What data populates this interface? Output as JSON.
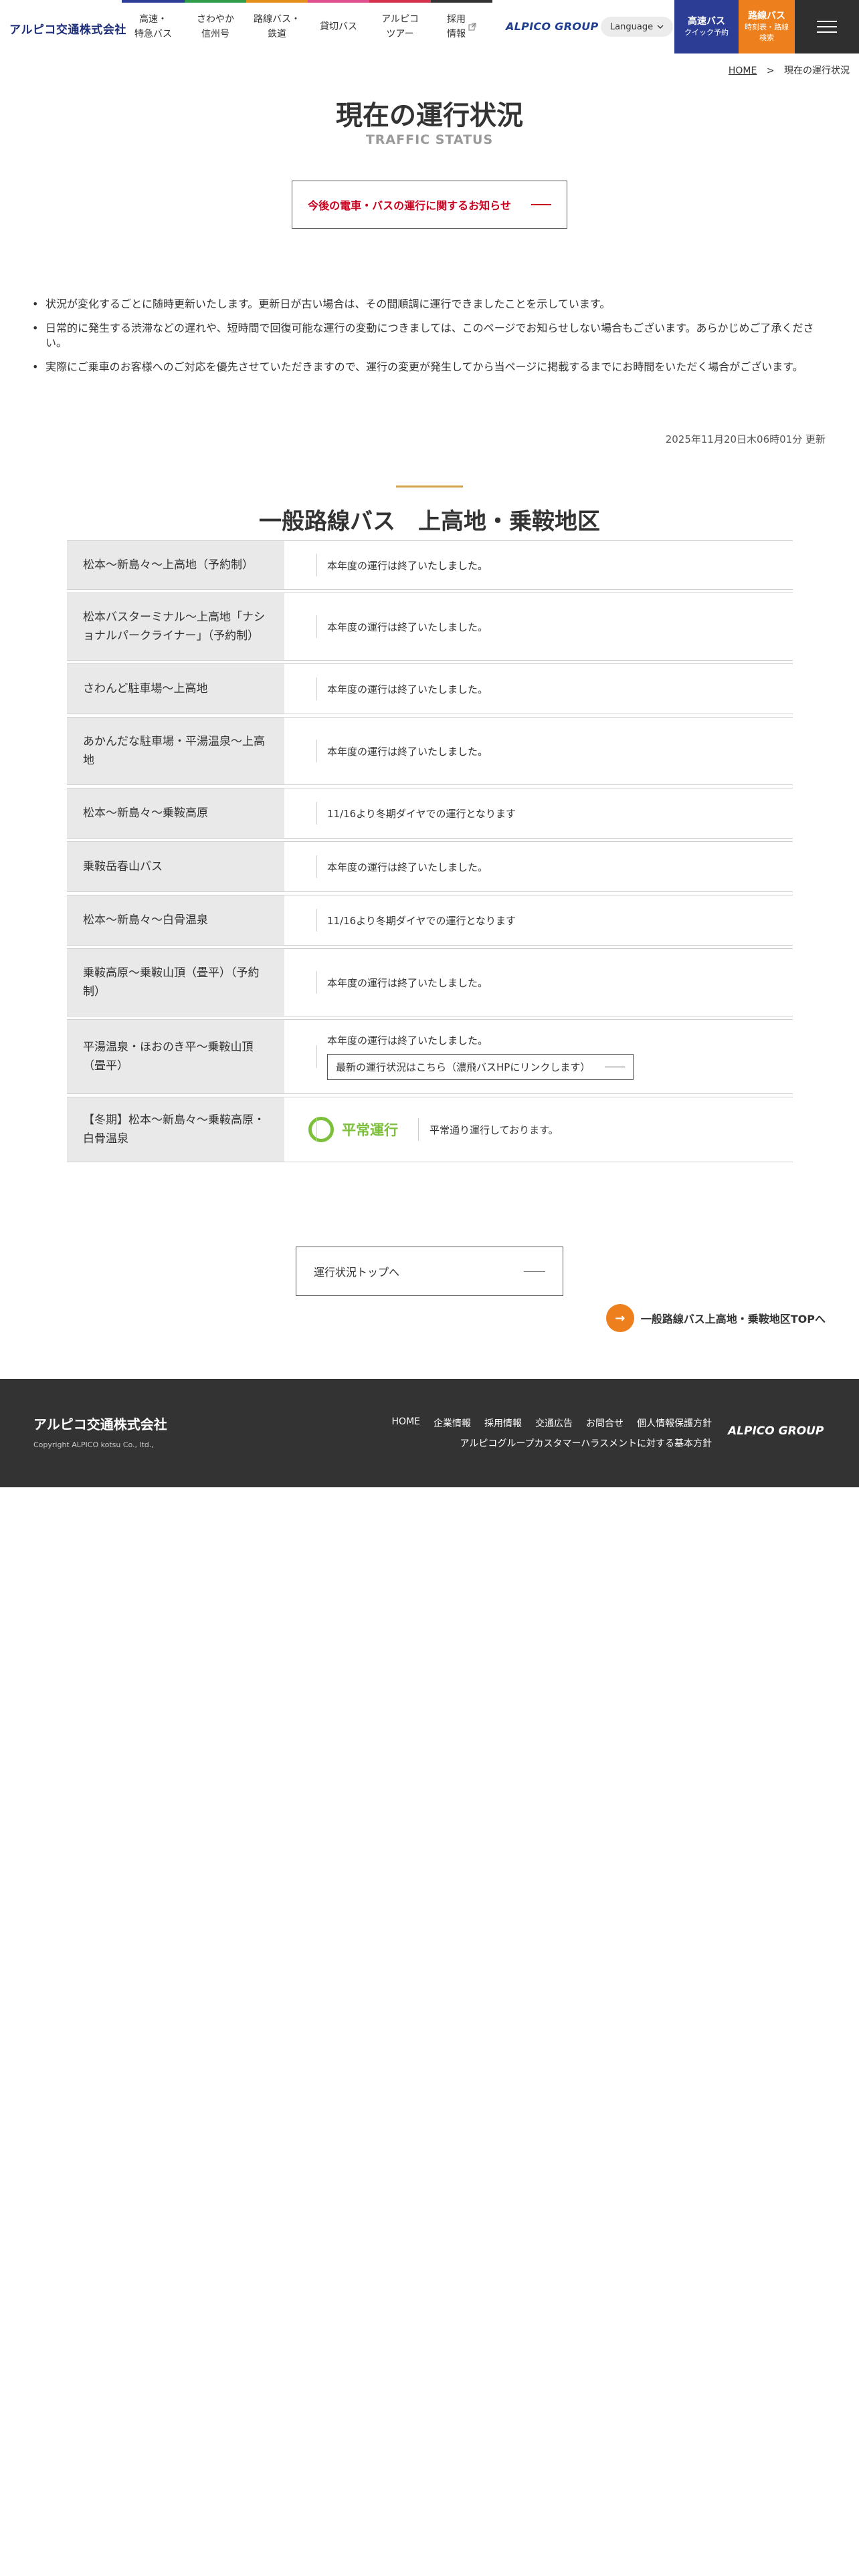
{
  "header": {
    "logo": "アルピコ交通株式会社",
    "nav": [
      {
        "label": "高速・\n特急バス",
        "color": "#2b3d95"
      },
      {
        "label": "さわやか\n信州号",
        "color": "#2e9c48"
      },
      {
        "label": "路線バス・\n鉄道",
        "color": "#e38f1a"
      },
      {
        "label": "貸切バス",
        "color": "#df4e8f"
      },
      {
        "label": "アルピコ\nツアー",
        "color": "#d5314c"
      },
      {
        "label": "採用\n情報",
        "color": "#333333"
      }
    ],
    "external_icon": "external-link-icon",
    "group_logo": "ALPICO GROUP",
    "language_label": "Language",
    "buttons": [
      {
        "main": "高速バス",
        "sub": "クイック予約",
        "color": "#2b3d95"
      },
      {
        "main": "路線バス",
        "sub": "時刻表・路線\n検索",
        "color": "#ee7f1d"
      }
    ],
    "menu_icon": "hamburger-icon"
  },
  "breadcrumb": {
    "home": "HOME",
    "separator": ">",
    "current": "現在の運行状況"
  },
  "page": {
    "title": "現在の運行状況",
    "subtitle": "TRAFFIC STATUS",
    "notice_button": "今後の電車・バスの運行に関するお知らせ",
    "bullets": [
      "状況が変化するごとに随時更新いたします。更新日が古い場合は、その間順調に運行できましたことを示しています。",
      "日常的に発生する渋滞などの遅れや、短時間で回復可能な運行の変動につきましては、このページでお知らせしない場合もございます。あらかじめご了承ください。",
      "実際にご乗車のお客様へのご対応を優先させていただきますので、運行の変更が発生してから当ページに掲載するまでにお時間をいただく場合がございます。"
    ],
    "updated": "2025年11月20日木06時01分 更新"
  },
  "section": {
    "title": "一般路線バス　上高地・乗鞍地区",
    "rows": [
      {
        "route": "松本～新島々～上高地（予約制）",
        "status": "本年度の運行は終了いたしました。"
      },
      {
        "route": "松本バスターミナル～上高地「ナショナルパークライナー」（予約制）",
        "status": "本年度の運行は終了いたしました。"
      },
      {
        "route": "さわんど駐車場～上高地",
        "status": "本年度の運行は終了いたしました。"
      },
      {
        "route": "あかんだな駐車場・平湯温泉～上高地",
        "status": "本年度の運行は終了いたしました。"
      },
      {
        "route": "松本～新島々～乗鞍高原",
        "status": "11/16より冬期ダイヤでの運行となります"
      },
      {
        "route": "乗鞍岳春山バス",
        "status": "本年度の運行は終了いたしました。"
      },
      {
        "route": "松本～新島々～白骨温泉",
        "status": "11/16より冬期ダイヤでの運行となります"
      },
      {
        "route": "乗鞍高原～乗鞍山頂（畳平）（予約制）",
        "status": "本年度の運行は終了いたしました。"
      },
      {
        "route": "平湯温泉・ほおのき平～乗鞍山頂（畳平）",
        "status": "本年度の運行は終了いたしました。",
        "link": "最新の運行状況はこちら（濃飛バスHPにリンクします）"
      },
      {
        "route": "【冬期】松本～新島々～乗鞍高原・白骨温泉",
        "normal_label": "平常運行",
        "status": "平常通り運行しております。",
        "normal_color": "#7cbf3a"
      }
    ]
  },
  "bottom": {
    "top_button": "運行状況トップへ",
    "area_top_arrow": "→",
    "area_top": "一般路線バス上高地・乗鞍地区TOPへ"
  },
  "footer": {
    "logo": "アルピコ交通株式会社",
    "copyright": "Copyright ALPICO kotsu Co., ltd.,",
    "links": [
      "HOME",
      "企業情報",
      "採用情報",
      "交通広告",
      "お問合せ",
      "個人情報保護方針"
    ],
    "link2": "アルピコグループカスタマーハラスメントに対する基本方針",
    "group_logo": "ALPICO GROUP"
  }
}
